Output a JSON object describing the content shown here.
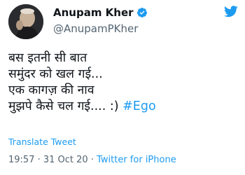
{
  "author": {
    "display_name": "Anupam Kher",
    "handle": "@AnupamPKher",
    "verified": true
  },
  "tweet": {
    "line1": "बस इतनी सी बात",
    "line2": "समुंदर को खल गई...",
    "line3": "एक कागज़ की नाव",
    "line4_text": "मुझपे कैसे चल गई.... :) ",
    "hashtag": "#Ego"
  },
  "translate_label": "Translate Tweet",
  "meta": {
    "time": "19:57",
    "separator1": " · ",
    "date": "31 Oct 20",
    "separator2": " · ",
    "source": "Twitter for iPhone"
  },
  "colors": {
    "accent": "#1d9bf0",
    "text": "#0f1419",
    "secondary": "#536471"
  },
  "icons": {
    "verified": "verified-badge-icon",
    "brand": "twitter-bird-icon"
  }
}
